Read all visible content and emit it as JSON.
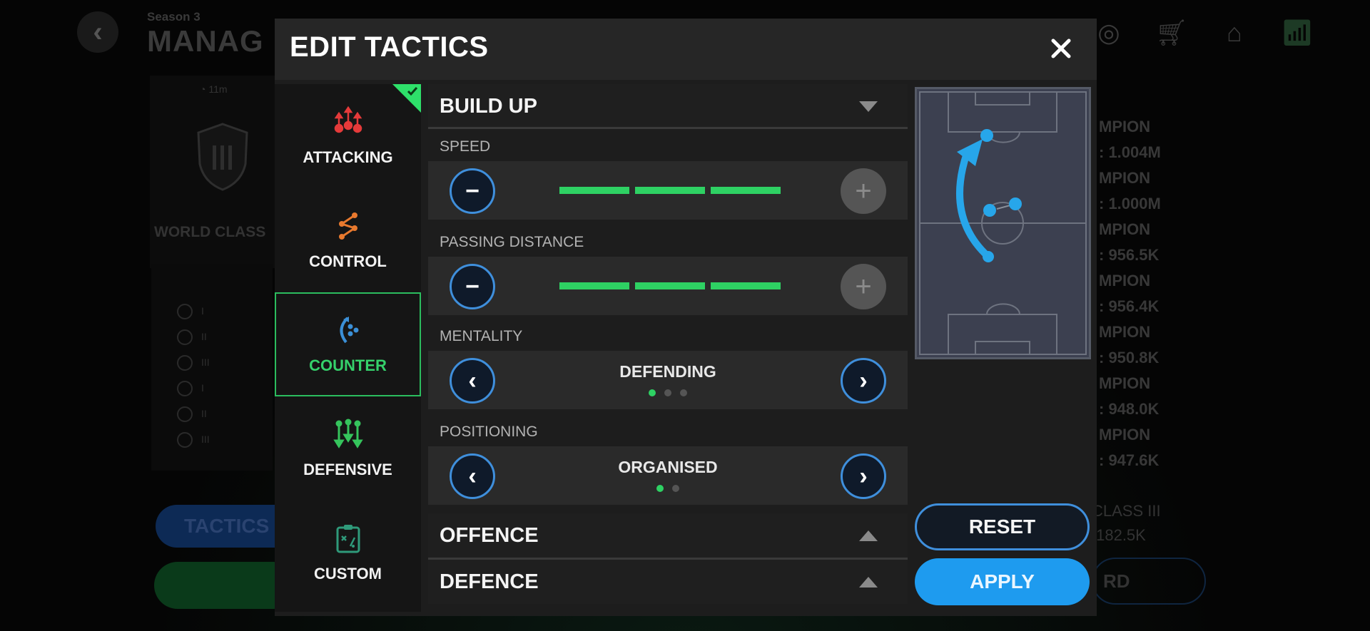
{
  "background": {
    "season": "Season 3",
    "title": "MANAG",
    "timer": "11m",
    "tier": "WORLD CLASS",
    "list_items": [
      "I",
      "II",
      "III",
      "I",
      "II",
      "III"
    ],
    "tactics_button": "TACTICS",
    "top_icons": [
      "target-icon",
      "cart-icon",
      "home-icon",
      "wifi-icon"
    ],
    "rankings": [
      {
        "title": "MPION",
        "score": ": 1.004M"
      },
      {
        "title": "MPION",
        "score": ": 1.000M"
      },
      {
        "title": "MPION",
        "score": ": 956.5K"
      },
      {
        "title": "MPION",
        "score": ": 956.4K"
      },
      {
        "title": "MPION",
        "score": ": 950.8K"
      },
      {
        "title": "MPION",
        "score": ": 948.0K"
      },
      {
        "title": "MPION",
        "score": ": 947.6K"
      }
    ],
    "own_rank": {
      "title": "CLASS III",
      "score": ":182.5K"
    },
    "right_button": "RD"
  },
  "modal": {
    "title": "EDIT TACTICS",
    "close_icon": "close-icon",
    "presets": [
      {
        "label": "ATTACKING",
        "icon": "attacking-icon",
        "color": "#e53a3a",
        "applied": true,
        "active": false
      },
      {
        "label": "CONTROL",
        "icon": "control-icon",
        "color": "#e8792e",
        "applied": false,
        "active": false
      },
      {
        "label": "COUNTER",
        "icon": "counter-icon",
        "color": "#3b8fd6",
        "applied": false,
        "active": true
      },
      {
        "label": "DEFENSIVE",
        "icon": "defensive-icon",
        "color": "#35c45c",
        "applied": false,
        "active": false
      },
      {
        "label": "CUSTOM",
        "icon": "custom-icon",
        "color": "#2f9a7a",
        "applied": false,
        "active": false
      }
    ],
    "sections": {
      "build_up": {
        "title": "BUILD UP",
        "expanded": true,
        "speed": {
          "label": "SPEED",
          "level": 3,
          "max": 3
        },
        "passing_distance": {
          "label": "PASSING DISTANCE",
          "level": 3,
          "max": 3
        },
        "mentality": {
          "label": "MENTALITY",
          "value": "DEFENDING",
          "index": 1,
          "count": 3
        },
        "positioning": {
          "label": "POSITIONING",
          "value": "ORGANISED",
          "index": 1,
          "count": 2
        }
      },
      "offence": {
        "title": "OFFENCE",
        "expanded": false
      },
      "defence": {
        "title": "DEFENCE",
        "expanded": false
      }
    },
    "reset_label": "RESET",
    "apply_label": "APPLY",
    "accent_green": "#2ed163",
    "accent_blue": "#1e9bef"
  }
}
